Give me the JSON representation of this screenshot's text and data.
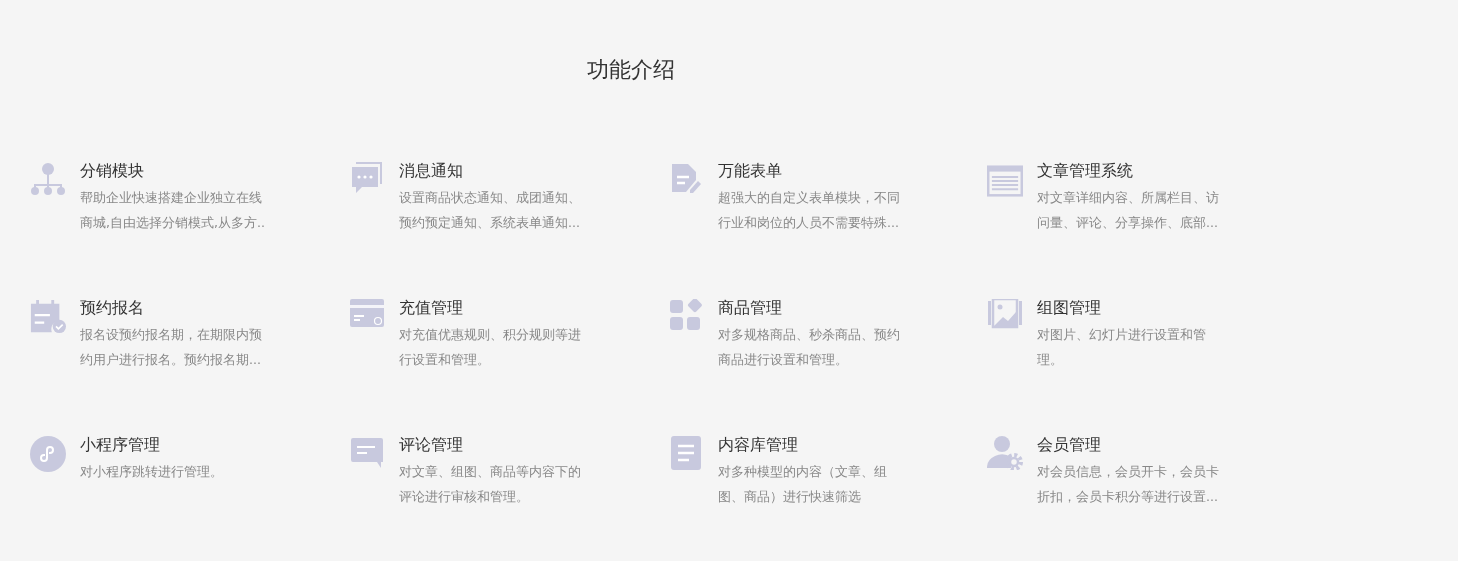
{
  "title": "功能介绍",
  "features": [
    {
      "name": "分销模块",
      "description_lines": [
        "帮助企业快速搭建企业独立在线",
        "商城,自由选择分销模式,从多方.."
      ]
    },
    {
      "name": "消息通知",
      "description_lines": [
        "设置商品状态通知、成团通知、",
        "预约预定通知、系统表单通知..."
      ]
    },
    {
      "name": "万能表单",
      "description_lines": [
        "超强大的自定义表单模块，不同",
        "行业和岗位的人员不需要特殊..."
      ]
    },
    {
      "name": "文章管理系统",
      "description_lines": [
        "对文章详细内容、所属栏目、访",
        "问量、评论、分享操作、底部..."
      ]
    },
    {
      "name": "预约报名",
      "description_lines": [
        "报名设预约报名期，在期限内预",
        "约用户进行报名。预约报名期..."
      ]
    },
    {
      "name": "充值管理",
      "description_lines": [
        "对充值优惠规则、积分规则等进",
        "行设置和管理。"
      ]
    },
    {
      "name": "商品管理",
      "description_lines": [
        "对多规格商品、秒杀商品、预约",
        "商品进行设置和管理。"
      ]
    },
    {
      "name": "组图管理",
      "description_lines": [
        "对图片、幻灯片进行设置和管",
        "理。"
      ]
    },
    {
      "name": "小程序管理",
      "description_lines": [
        "对小程序跳转进行管理。"
      ]
    },
    {
      "name": "评论管理",
      "description_lines": [
        "对文章、组图、商品等内容下的",
        "评论进行审核和管理。"
      ]
    },
    {
      "name": "内容库管理",
      "description_lines": [
        "对多种模型的内容（文章、组",
        "图、商品）进行快速筛选"
      ]
    },
    {
      "name": "会员管理",
      "description_lines": [
        "对会员信息，会员开卡，会员卡",
        "折扣，会员卡积分等进行设置..."
      ]
    }
  ]
}
